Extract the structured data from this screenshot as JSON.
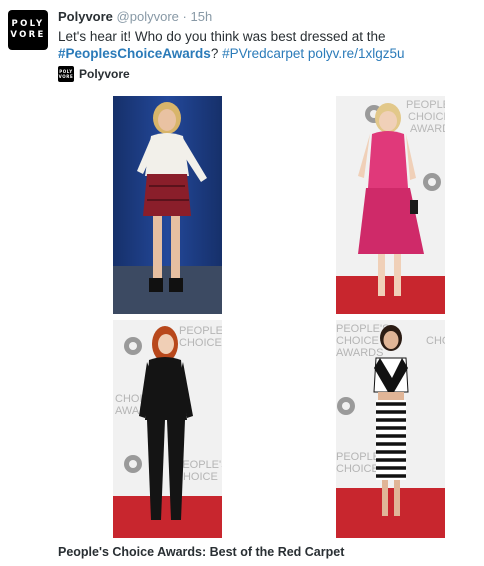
{
  "tweet": {
    "author_name": "Polyvore",
    "author_handle": "@polyvore",
    "separator": "·",
    "timestamp": "15h",
    "avatar_line1": "POLY",
    "avatar_line2": "VORE",
    "text_intro": "Let's hear it! Who do you think was best dressed at the",
    "hashtag_1": "#PeoplesChoiceAwards",
    "question_mark": "?",
    "hashtag_2": "#PVredcarpet",
    "link": "polyv.re/1xlgz5u"
  },
  "card": {
    "source_name": "Polyvore",
    "source_logo_line1": "POLY",
    "source_logo_line2": "VORE",
    "caption": "People's Choice Awards: Best of the Red Carpet"
  },
  "backdrop": {
    "line1": "PEOPLE'S",
    "line2": "CHOICE",
    "line3": "AWARDS"
  },
  "colors": {
    "link": "#2b7bb9",
    "handle": "#8899a6",
    "carpet": "#c8262e",
    "backdrop_blue": "#1a3a7c",
    "pink_dress": "#e0397a"
  }
}
